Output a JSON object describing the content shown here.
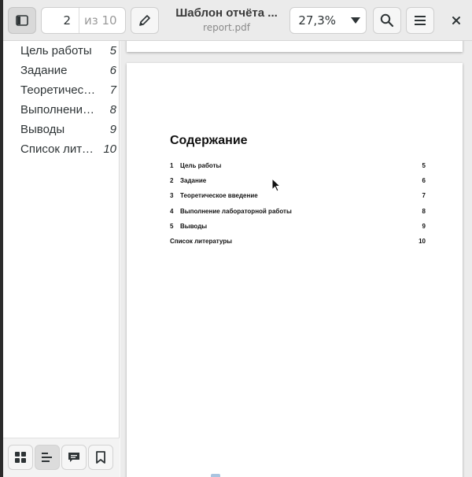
{
  "header": {
    "page_number": "2",
    "page_of": "из 10",
    "title": "Шаблон отчёта ...",
    "subtitle": "report.pdf",
    "zoom": "27,3%"
  },
  "sidebar": {
    "outline": [
      {
        "label": "Цель работы",
        "page": "5"
      },
      {
        "label": "Задание",
        "page": "6"
      },
      {
        "label": "Теоретичес…",
        "page": "7"
      },
      {
        "label": "Выполнение…",
        "page": "8"
      },
      {
        "label": "Выводы",
        "page": "9"
      },
      {
        "label": "Список лите…",
        "page": "10"
      }
    ],
    "tabs": [
      "thumbnails-icon",
      "outline-icon",
      "annotations-icon",
      "bookmarks-icon"
    ]
  },
  "document": {
    "toc_heading": "Содержание",
    "toc": [
      {
        "num": "1",
        "title": "Цель работы",
        "page": "5"
      },
      {
        "num": "2",
        "title": "Задание",
        "page": "6"
      },
      {
        "num": "3",
        "title": "Теоретическое введение",
        "page": "7"
      },
      {
        "num": "4",
        "title": "Выполнение лабораторной работы",
        "page": "8"
      },
      {
        "num": "5",
        "title": "Выводы",
        "page": "9"
      },
      {
        "num": "",
        "title": "Список литературы",
        "page": "10"
      }
    ]
  },
  "colors": {
    "headerbar": "#ebebeb",
    "sidebar": "#ffffff",
    "doc_background": "#ececec",
    "text": "#2e3436"
  }
}
